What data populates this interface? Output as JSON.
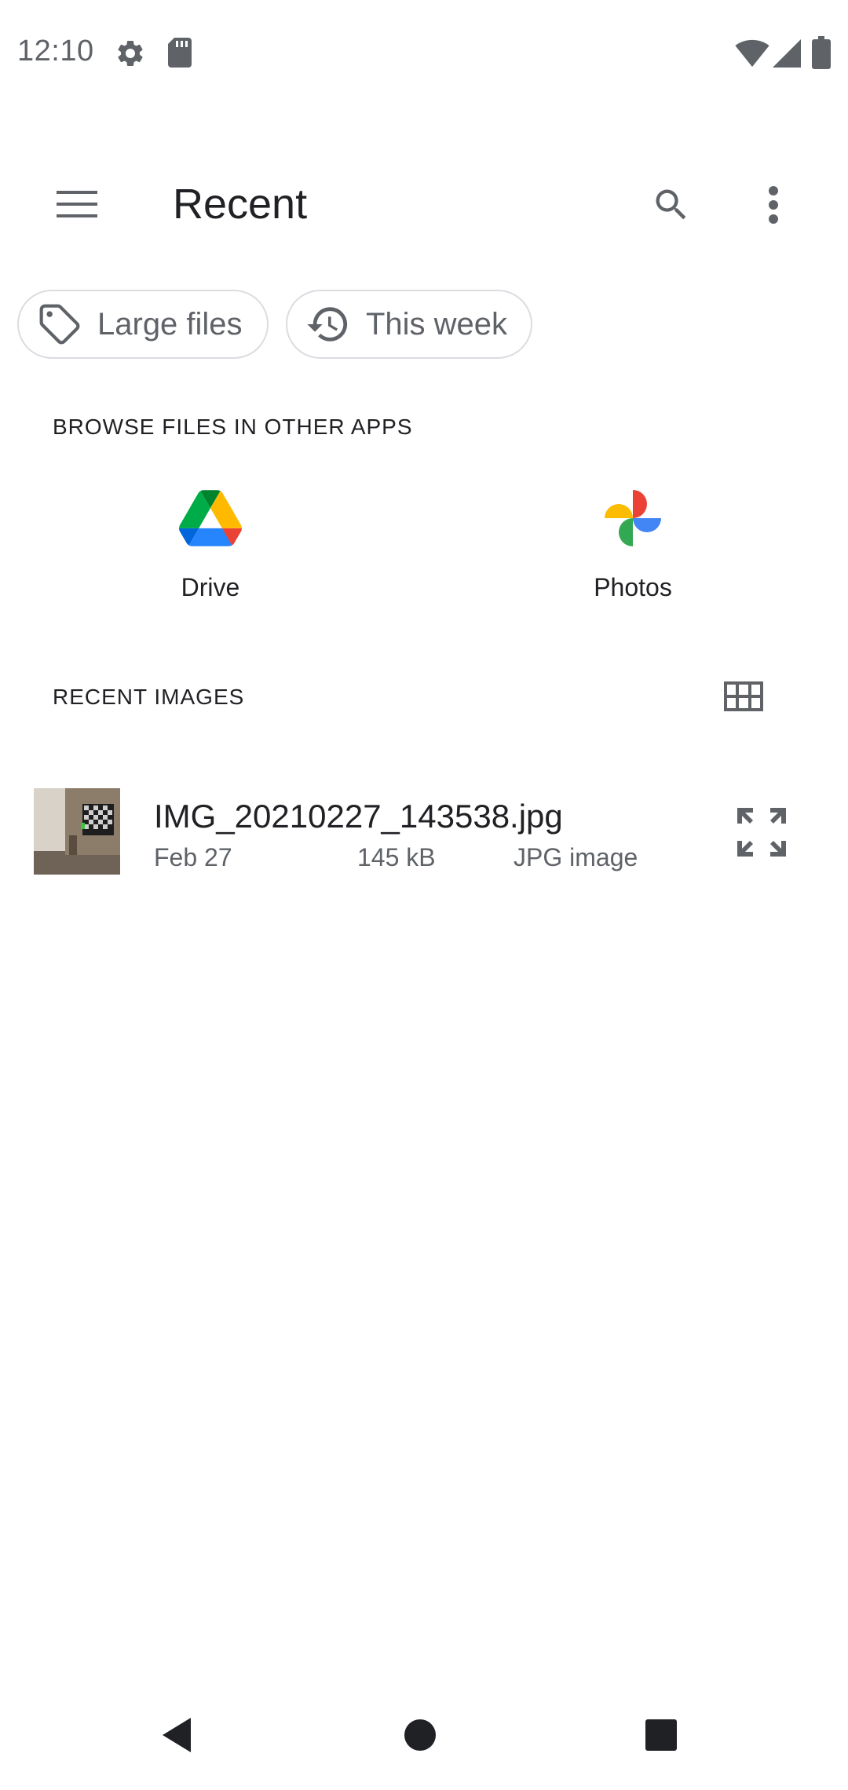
{
  "status_bar": {
    "time": "12:10",
    "icons": [
      "gear-icon",
      "sd-card-icon",
      "wifi-icon",
      "signal-icon",
      "battery-icon"
    ]
  },
  "app_bar": {
    "title": "Recent",
    "icons": [
      "menu-icon",
      "search-icon",
      "more-vert-icon"
    ]
  },
  "chips": [
    {
      "label": "Large files",
      "icon": "tag-icon"
    },
    {
      "label": "This week",
      "icon": "history-icon"
    }
  ],
  "browse_section": {
    "header": "BROWSE FILES IN OTHER APPS",
    "apps": [
      {
        "label": "Drive",
        "icon": "google-drive-logo"
      },
      {
        "label": "Photos",
        "icon": "google-photos-logo"
      }
    ]
  },
  "recent_section": {
    "header": "RECENT IMAGES",
    "view_toggle_icon": "grid-view-icon",
    "files": [
      {
        "name": "IMG_20210227_143538.jpg",
        "date": "Feb 27",
        "size": "145 kB",
        "type": "JPG image",
        "action_icon": "expand-icon"
      }
    ]
  },
  "nav_bar": {
    "icons": [
      "back-icon",
      "home-icon",
      "recents-icon"
    ]
  },
  "colors": {
    "text_primary": "#202124",
    "text_secondary": "#5f6368",
    "chip_border": "#dadce0",
    "icon_gray": "#5f6368"
  }
}
